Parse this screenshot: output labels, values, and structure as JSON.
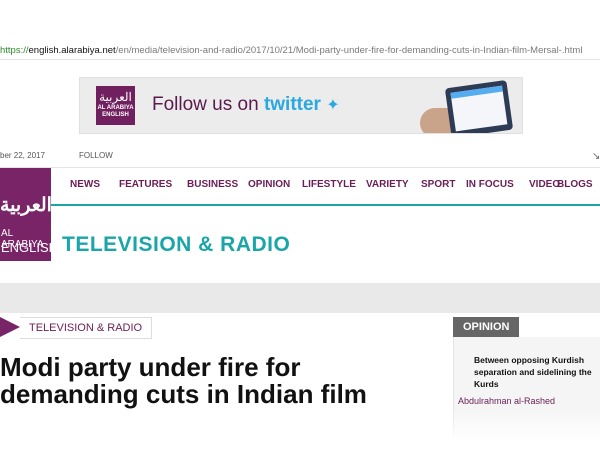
{
  "browser": {
    "url_protocol": "https://",
    "url_host": "english.alarabiya.net",
    "url_path": "/en/media/television-and-radio/2017/10/21/Modi-party-under-fire-for-demanding-cuts-in-Indian-film-Mersal-.html"
  },
  "ad": {
    "logo_arabic": "العربية",
    "logo_line1": "AL ARABIYA",
    "logo_line2": "ENGLISH",
    "follow_text": "Follow us on",
    "brand": "twitter"
  },
  "header": {
    "date": "ber 22, 2017",
    "follow": "FOLLOW"
  },
  "site_logo": {
    "arabic": "العربية",
    "line1": "AL ARABIYA",
    "line2": "ENGLISH"
  },
  "nav": {
    "items": [
      "NEWS",
      "FEATURES",
      "BUSINESS",
      "OPINION",
      "LIFESTYLE",
      "VARIETY",
      "SPORT",
      "IN FOCUS",
      "VIDEO",
      "BLOGS"
    ]
  },
  "section": {
    "title": "TELEVISION & RADIO"
  },
  "article": {
    "category": "TELEVISION & RADIO",
    "headline": "Modi party under fire for demanding cuts in Indian film"
  },
  "opinion": {
    "label": "OPINION",
    "title": "Between opposing Kurdish separation and sidelining the Kurds",
    "author": "Abdulrahman al-Rashed"
  },
  "colors": {
    "brand_purple": "#7a2468",
    "teal": "#1aa6a8",
    "twitter_blue": "#2aa9e0"
  }
}
